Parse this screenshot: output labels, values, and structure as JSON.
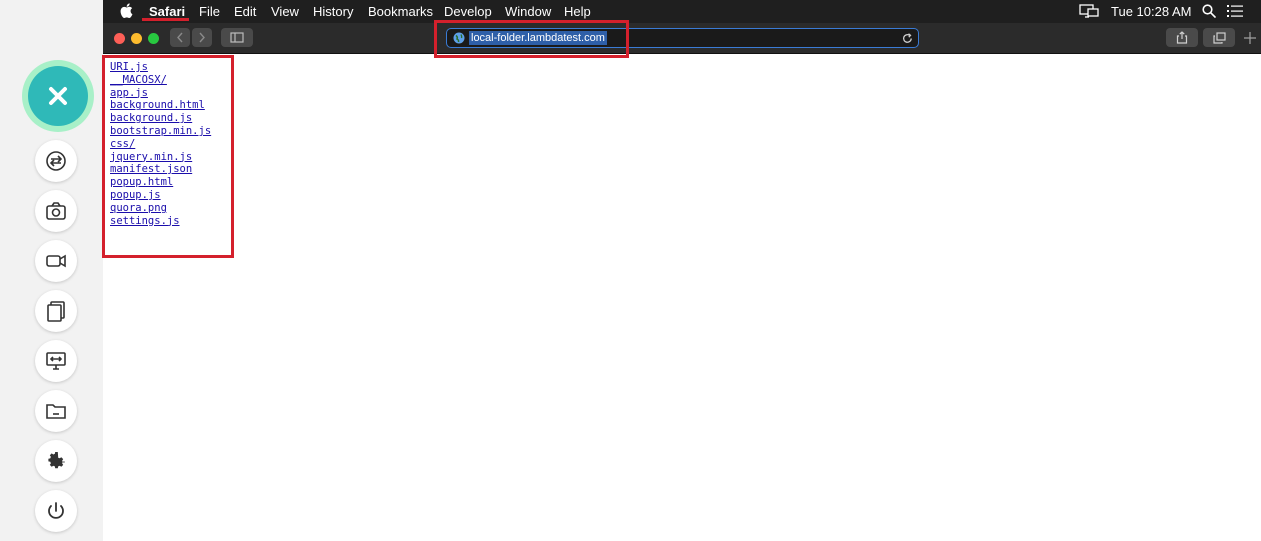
{
  "menubar": {
    "app_name": "Safari",
    "menus": [
      "File",
      "Edit",
      "View",
      "History",
      "Bookmarks",
      "Develop",
      "Window",
      "Help"
    ],
    "clock": "Tue 10:28 AM"
  },
  "toolbar": {
    "address": "local-folder.lambdatest.com"
  },
  "files": [
    "URI.js",
    "__MACOSX/",
    "app.js",
    "background.html",
    "background.js",
    "bootstrap.min.js",
    "css/",
    "jquery.min.js",
    "manifest.json",
    "popup.html",
    "popup.js",
    "quora.png",
    "settings.js"
  ],
  "sidebar": {
    "tools": [
      "switch-icon",
      "camera-icon",
      "video-icon",
      "gallery-icon",
      "screen-resolution-icon",
      "folder-icon",
      "gear-icon",
      "power-icon"
    ]
  },
  "colors": {
    "highlight": "#d4202c",
    "close_button": "#2fb9b8",
    "link": "#1a0dab"
  }
}
